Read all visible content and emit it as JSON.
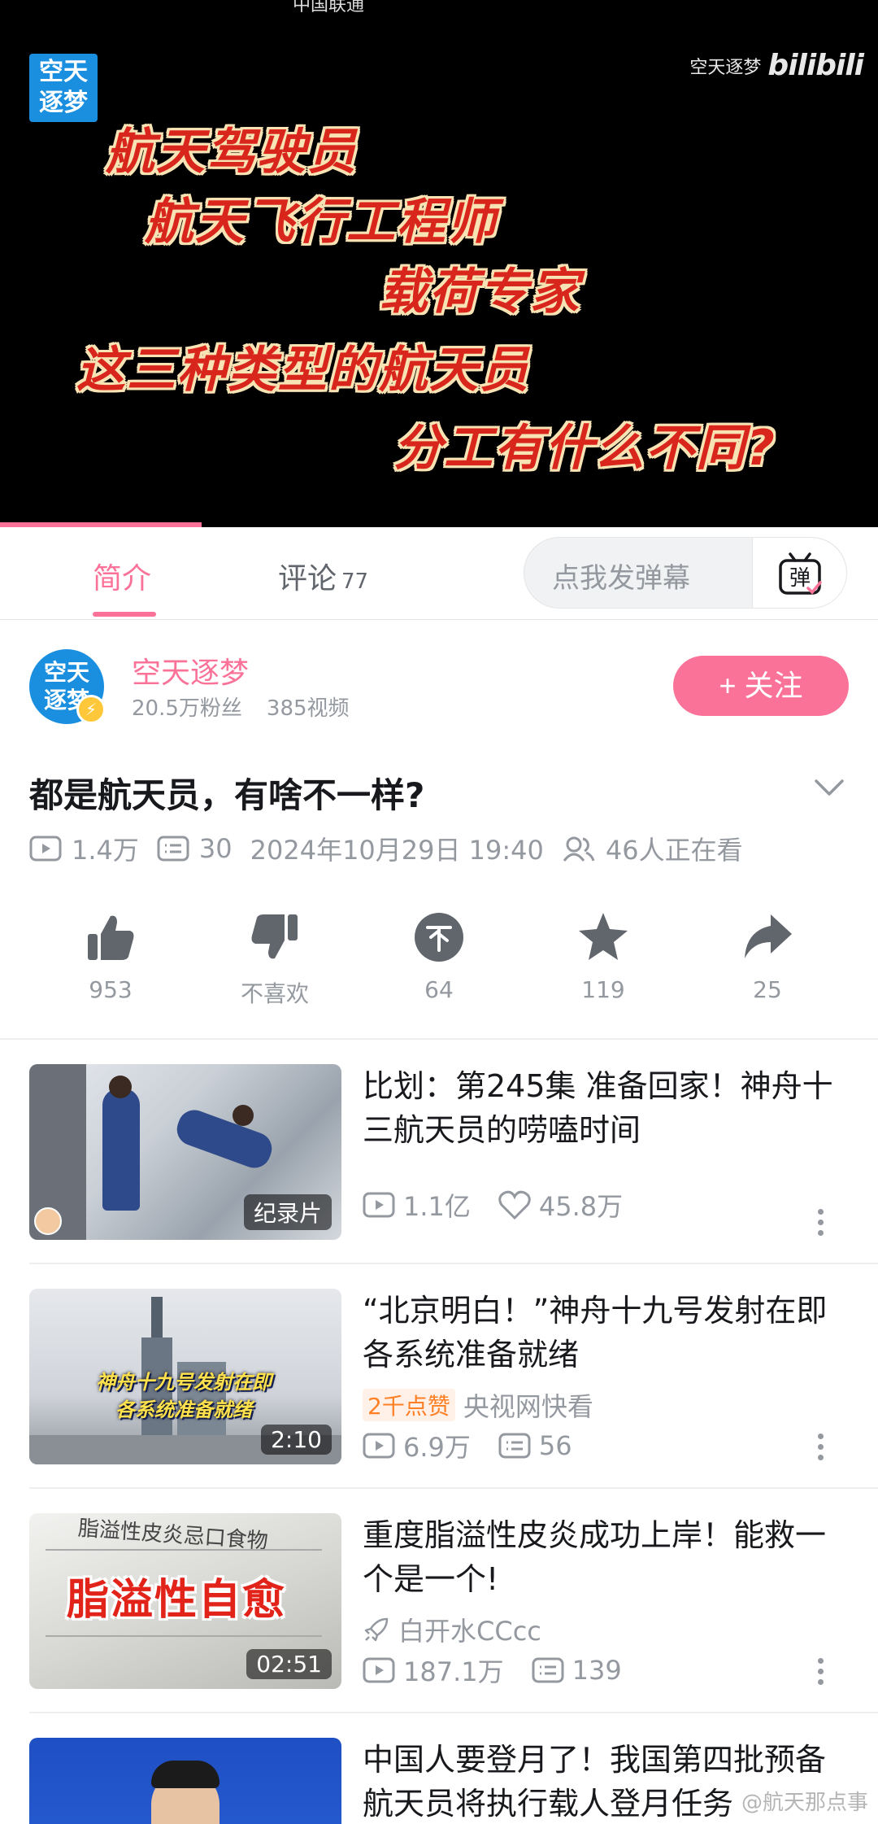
{
  "player": {
    "status_text_left": "中国联通",
    "channel_logo": "空天\n逐梦",
    "brand_name": "空天逐梦",
    "brand_logo_text": "bilibili",
    "headline_lines": [
      "航天驾驶员",
      "航天飞行工程师",
      "载荷专家",
      "这三种类型的航天员",
      "分工有什么不同?"
    ],
    "progress_fraction": 0.23
  },
  "tabs": {
    "intro": "简介",
    "comments": "评论",
    "comments_count": "77",
    "danmaku_placeholder": "点我发弹幕",
    "danmaku_icon": "弹"
  },
  "author": {
    "avatar_text": "空天\n逐梦",
    "name": "空天逐梦",
    "fans": "20.5万粉丝",
    "videos": "385视频",
    "follow_label": "+ 关注"
  },
  "video": {
    "title": "都是航天员，有啥不一样?",
    "views": "1.4万",
    "danmaku": "30",
    "date": "2024年10月29日 19:40",
    "watching": "46人正在看"
  },
  "actions": [
    {
      "label": "953"
    },
    {
      "label": "不喜欢"
    },
    {
      "label": "64"
    },
    {
      "label": "119"
    },
    {
      "label": "25"
    }
  ],
  "recommendations": [
    {
      "title": "比划：第245集 准备回家！神舟十三航天员的唠嗑时间",
      "thumb_tag": "纪录片",
      "views": "1.1亿",
      "likes": "45.8万"
    },
    {
      "title": "“北京明白！”神舟十九号发射在即 各系统准备就绪",
      "thumb_overlay": "神舟十九号发射在即\n各系统准备就绪",
      "duration": "2:10",
      "badge": "2千点赞",
      "uploader": "央视网快看",
      "views": "6.9万",
      "danmaku": "56"
    },
    {
      "title": "重度脂溢性皮炎成功上岸！能救一个是一个!",
      "thumb_top": "脂溢性皮炎忌口食物",
      "thumb_overlay": "脂溢性自愈",
      "duration": "02:51",
      "uploader": "白开水CCcc",
      "views": "187.1万",
      "danmaku": "139"
    },
    {
      "title": "中国人要登月了！我国第四批预备航天员将执行载人登月任务"
    }
  ],
  "watermark": "@航天那点事"
}
